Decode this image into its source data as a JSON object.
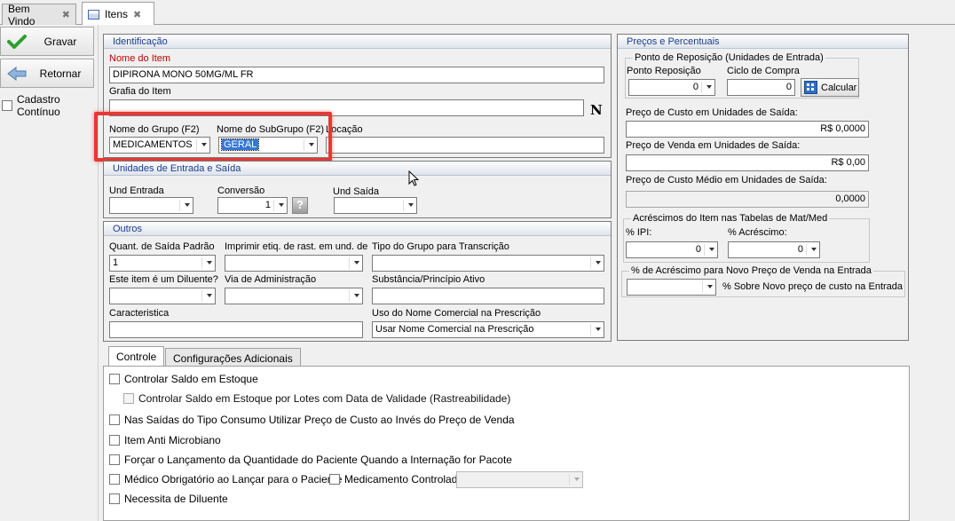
{
  "tabs": [
    {
      "label": "Bem Vindo"
    },
    {
      "label": "Itens"
    }
  ],
  "toolbar": {
    "save_label": "Gravar",
    "return_label": "Retornar",
    "continuous_label": "Cadastro Contínuo"
  },
  "identificacao": {
    "title": "Identificação",
    "nome_label": "Nome do Item",
    "nome_value": "DIPIRONA MONO 50MG/ML FR",
    "grafia_label": "Grafia do Item",
    "grafia_value": "",
    "n_button": "N",
    "grupo_label": "Nome do Grupo (F2)",
    "grupo_value": "MEDICAMENTOS",
    "subgrupo_label": "Nome do SubGrupo (F2)",
    "subgrupo_value": "GERAL",
    "locacao_label": "Locação",
    "locacao_value": ""
  },
  "unidades": {
    "title": "Unidades de Entrada e Saída",
    "entrada_label": "Und Entrada",
    "entrada_value": "",
    "conversao_label": "Conversão",
    "conversao_value": "1",
    "help": "?",
    "saida_label": "Und Saída",
    "saida_value": ""
  },
  "outros": {
    "title": "Outros",
    "quant_label": "Quant. de Saída Padrão",
    "quant_value": "1",
    "imprimir_label": "Imprimir etiq. de rast. em und. de",
    "imprimir_value": "",
    "tipo_label": "Tipo do Grupo para Transcrição",
    "tipo_value": "",
    "diluente_label": "Este item é um Diluente?",
    "diluente_value": "",
    "via_label": "Via de Administração",
    "via_value": "",
    "substancia_label": "Substância/Princípio Ativo",
    "substancia_value": "",
    "caracteristica_label": "Caracteristica",
    "caracteristica_value": "",
    "uso_label": "Uso do Nome Comercial na Prescrição",
    "uso_value": "Usar Nome Comercial na Prescrição"
  },
  "precos": {
    "title": "Preços e Percentuais",
    "ponto_title": "Ponto de Reposição (Unidades de Entrada)",
    "ponto_label": "Ponto Reposição",
    "ponto_value": "0",
    "ciclo_label": "Ciclo de Compra",
    "ciclo_value": "0",
    "calcular_label": "Calcular",
    "custo_label": "Preço de Custo em Unidades de Saída:",
    "custo_value": "R$ 0,0000",
    "venda_label": "Preço de Venda em Unidades de Saída:",
    "venda_value": "R$ 0,00",
    "medio_label": "Preço de Custo Médio em Unidades de Saída:",
    "medio_value": "0,0000",
    "acresc_title": "Acréscimos do Item nas Tabelas de Mat/Med",
    "ipi_label": "% IPI:",
    "ipi_value": "0",
    "acrescimo_label": "% Acréscimo:",
    "acrescimo_value": "0",
    "novo_title": "% de Acréscimo para Novo Preço de Venda na Entrada",
    "novo_value": "",
    "novo_label": "% Sobre Novo preço de custo na Entrada"
  },
  "content_tabs": [
    {
      "label": "Controle"
    },
    {
      "label": "Configurações Adicionais"
    }
  ],
  "controle": {
    "c1": "Controlar Saldo em Estoque",
    "c2": "Controlar Saldo em Estoque por Lotes com Data de Validade (Rastreabilidade)",
    "c3": "Nas Saídas do Tipo Consumo Utilizar Preço de Custo ao Invés do Preço de Venda",
    "c4": "Item Anti Microbiano",
    "c5": "Forçar o Lançamento da Quantidade do Paciente Quando a Internação for Pacote",
    "c6": "Médico Obrigatório ao Lançar para o Paciente",
    "c7": "Medicamento Controlado",
    "c7_value": "",
    "c8": "Necessita de Diluente"
  },
  "colors": {
    "highlight": "#e53935",
    "accent": "#1a3d8f",
    "required": "#c00000"
  }
}
